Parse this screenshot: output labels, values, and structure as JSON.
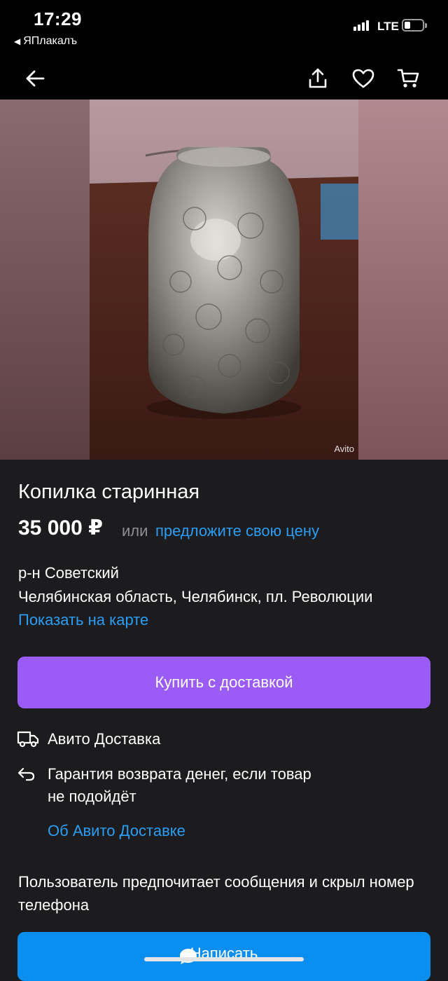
{
  "status_bar": {
    "time": "17:29",
    "back_app": "ЯПлакалъ",
    "network": "LTE"
  },
  "nav": {
    "icons": [
      "back-arrow-icon",
      "share-icon",
      "heart-icon",
      "cart-icon"
    ]
  },
  "photo": {
    "watermark": "Avito"
  },
  "listing": {
    "title": "Копилка старинная",
    "price": "35 000 ₽",
    "or_text": "или",
    "offer_link": "предложите свою цену",
    "district": "р-н Советский",
    "address": "Челябинская область, Челябинск, пл. Революции",
    "map_link": "Показать на карте"
  },
  "buy_button": {
    "label": "Купить с доставкой"
  },
  "delivery": {
    "title": "Авито Доставка",
    "guarantee_line1": "Гарантия возврата денег, если товар",
    "guarantee_line2": "не подойдёт",
    "about_link": "Об Авито Доставке"
  },
  "contact": {
    "preference": "Пользователь предпочитает сообщения и скрыл номер телефона",
    "write_button": "Написать"
  },
  "colors": {
    "background": "#1c1c1e",
    "accent_link": "#2a9df4",
    "buy_button": "#9b5cf6",
    "write_button": "#0a8ff0"
  }
}
